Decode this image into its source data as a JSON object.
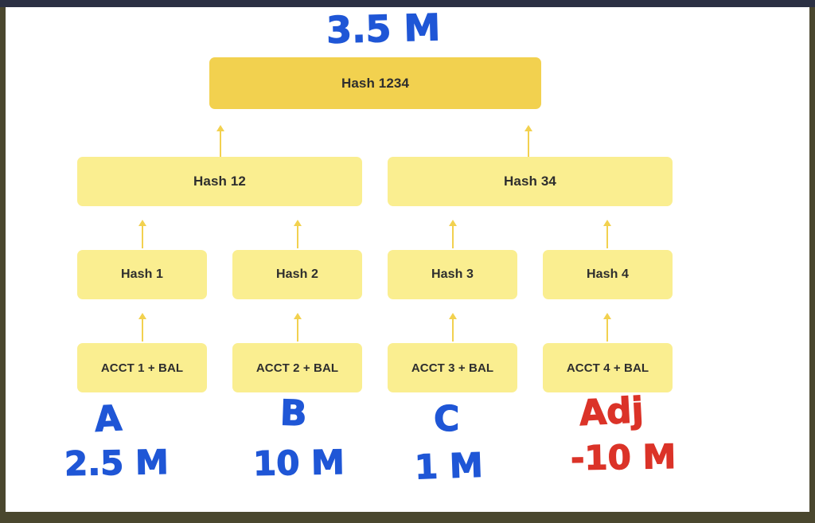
{
  "diagram": {
    "title": "Merkle tree of account balances with handwritten annotations",
    "colors": {
      "root_fill": "#f2d14f",
      "node_fill": "#faee90",
      "arrow": "#f2d14f",
      "ink_blue": "#1f56d6",
      "ink_red": "#db3328",
      "topbar": "#2b3043",
      "outer_border": "#4a472e"
    },
    "levels": {
      "root": {
        "label": "Hash 1234"
      },
      "branch": [
        {
          "label": "Hash 12"
        },
        {
          "label": "Hash 34"
        }
      ],
      "hashes": [
        {
          "label": "Hash 1"
        },
        {
          "label": "Hash 2"
        },
        {
          "label": "Hash 3"
        },
        {
          "label": "Hash 4"
        }
      ],
      "leaves": [
        {
          "label": "ACCT 1 + BAL"
        },
        {
          "label": "ACCT 2 + BAL"
        },
        {
          "label": "ACCT 3 + BAL"
        },
        {
          "label": "ACCT 4 + BAL"
        }
      ]
    },
    "annotations": {
      "root_total": {
        "text": "3.5 M",
        "ink": "blue"
      },
      "accounts": [
        {
          "letter": "A",
          "value": "2.5 M",
          "ink": "blue"
        },
        {
          "letter": "B",
          "value": "10 M",
          "ink": "blue"
        },
        {
          "letter": "C",
          "value": "1 M",
          "ink": "blue"
        },
        {
          "letter": "Adj",
          "value": "-10 M",
          "ink": "red"
        }
      ]
    }
  }
}
